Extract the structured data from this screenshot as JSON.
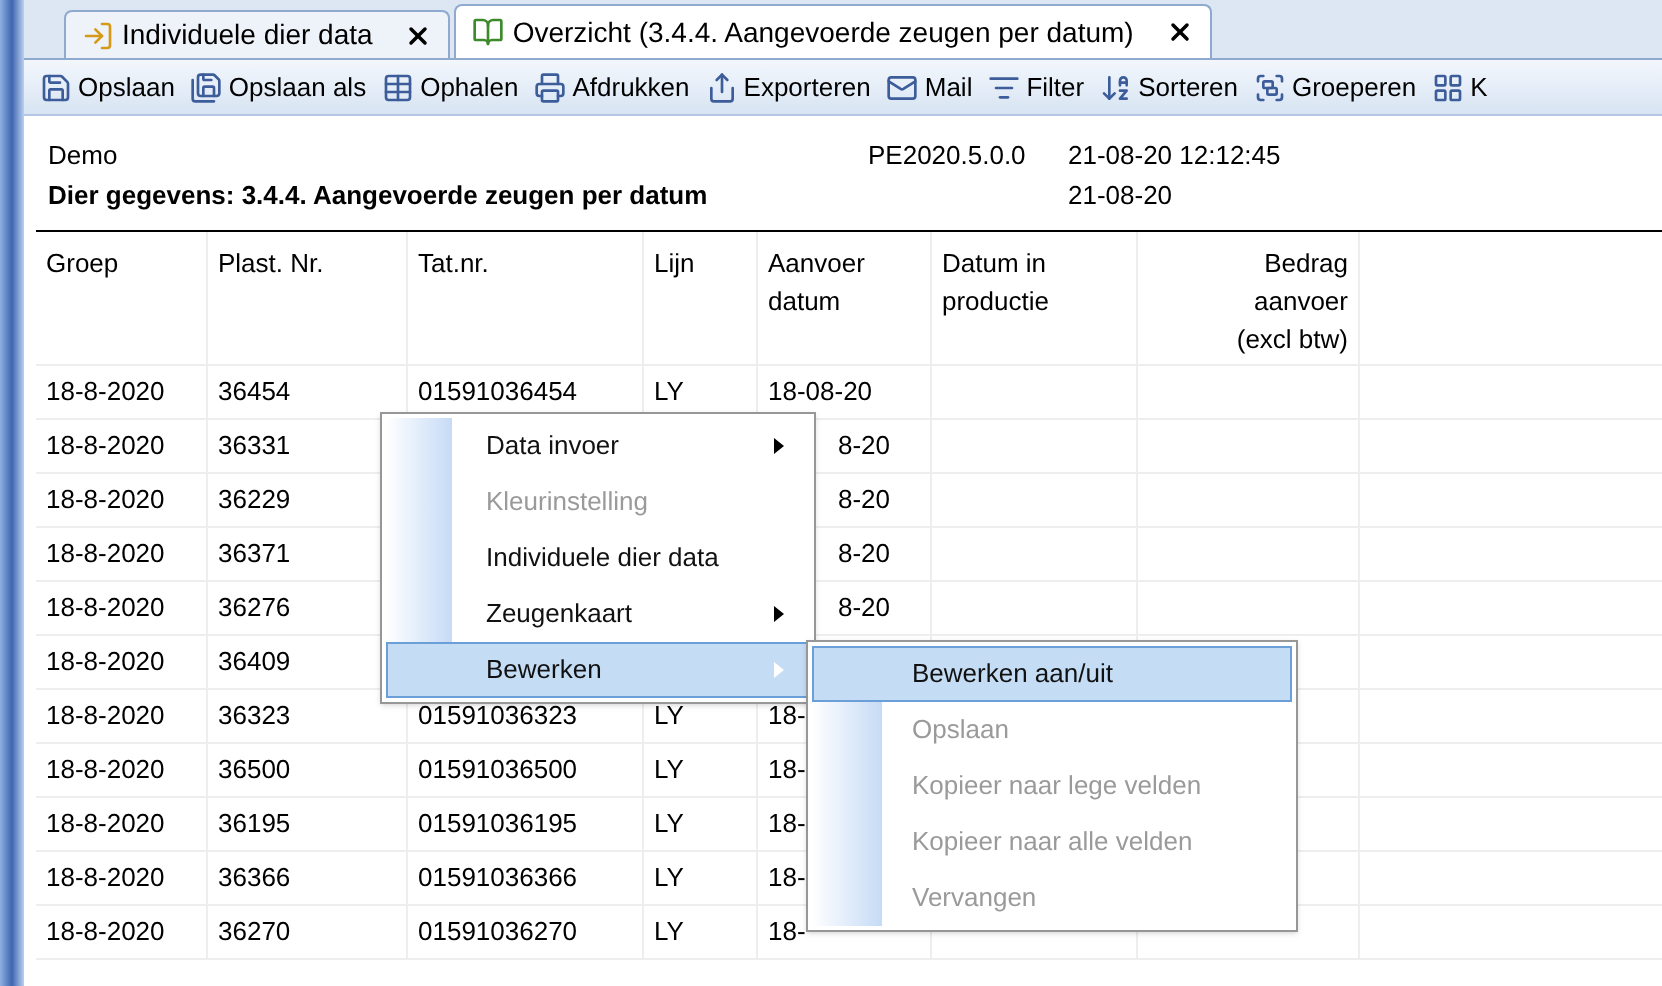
{
  "tabs": [
    {
      "label": "Individuele dier data",
      "selected": false
    },
    {
      "label": "Overzicht (3.4.4. Aangevoerde zeugen per datum)",
      "selected": true
    }
  ],
  "toolbar": [
    "Opslaan",
    "Opslaan als",
    "Ophalen",
    "Afdrukken",
    "Exporteren",
    "Mail",
    "Filter",
    "Sorteren",
    "Groeperen",
    "K"
  ],
  "report": {
    "company": "Demo",
    "title": "Dier gegevens: 3.4.4. Aangevoerde zeugen per datum",
    "version": "PE2020.5.0.0",
    "printed": "21-08-20 12:12:45",
    "date": "21-08-20"
  },
  "columns": [
    "Groep",
    "Plast. Nr.",
    "Tat.nr.",
    "Lijn",
    "Aanvoer datum",
    "Datum in productie",
    "Bedrag aanvoer (excl btw)"
  ],
  "rows": [
    {
      "groep": "18-8-2020",
      "plast_nr": "36454",
      "tat_nr": "01591036454",
      "lijn": "LY",
      "aanvoer_datum": "18-08-20"
    },
    {
      "groep": "18-8-2020",
      "plast_nr": "36331",
      "aanvoer_datum": "8-20"
    },
    {
      "groep": "18-8-2020",
      "plast_nr": "36229",
      "aanvoer_datum": "8-20"
    },
    {
      "groep": "18-8-2020",
      "plast_nr": "36371",
      "aanvoer_datum": "8-20"
    },
    {
      "groep": "18-8-2020",
      "plast_nr": "36276",
      "aanvoer_datum": "8-20"
    },
    {
      "groep": "18-8-2020",
      "plast_nr": "36409"
    },
    {
      "groep": "18-8-2020",
      "plast_nr": "36323",
      "tat_nr": "01591036323",
      "lijn": "LY",
      "aanvoer_datum": "18-"
    },
    {
      "groep": "18-8-2020",
      "plast_nr": "36500",
      "tat_nr": "01591036500",
      "lijn": "LY",
      "aanvoer_datum": "18-"
    },
    {
      "groep": "18-8-2020",
      "plast_nr": "36195",
      "tat_nr": "01591036195",
      "lijn": "LY",
      "aanvoer_datum": "18-"
    },
    {
      "groep": "18-8-2020",
      "plast_nr": "36366",
      "tat_nr": "01591036366",
      "lijn": "LY",
      "aanvoer_datum": "18-"
    },
    {
      "groep": "18-8-2020",
      "plast_nr": "36270",
      "tat_nr": "01591036270",
      "lijn": "LY",
      "aanvoer_datum": "18-"
    }
  ],
  "context_menu": [
    {
      "label": "Data invoer",
      "submenu": true,
      "disabled": false,
      "selected": false
    },
    {
      "label": "Kleurinstelling",
      "submenu": false,
      "disabled": true,
      "selected": false
    },
    {
      "label": "Individuele dier data",
      "submenu": false,
      "disabled": false,
      "selected": false
    },
    {
      "label": "Zeugenkaart",
      "submenu": true,
      "disabled": false,
      "selected": false
    },
    {
      "label": "Bewerken",
      "submenu": true,
      "disabled": false,
      "selected": true
    }
  ],
  "submenu": [
    {
      "label": "Bewerken aan/uit",
      "disabled": false,
      "selected": true
    },
    {
      "label": "Opslaan",
      "disabled": true,
      "selected": false
    },
    {
      "label": "Kopieer naar lege velden",
      "disabled": true,
      "selected": false
    },
    {
      "label": "Kopieer naar alle velden",
      "disabled": true,
      "selected": false
    },
    {
      "label": "Vervangen",
      "disabled": true,
      "selected": false
    }
  ]
}
